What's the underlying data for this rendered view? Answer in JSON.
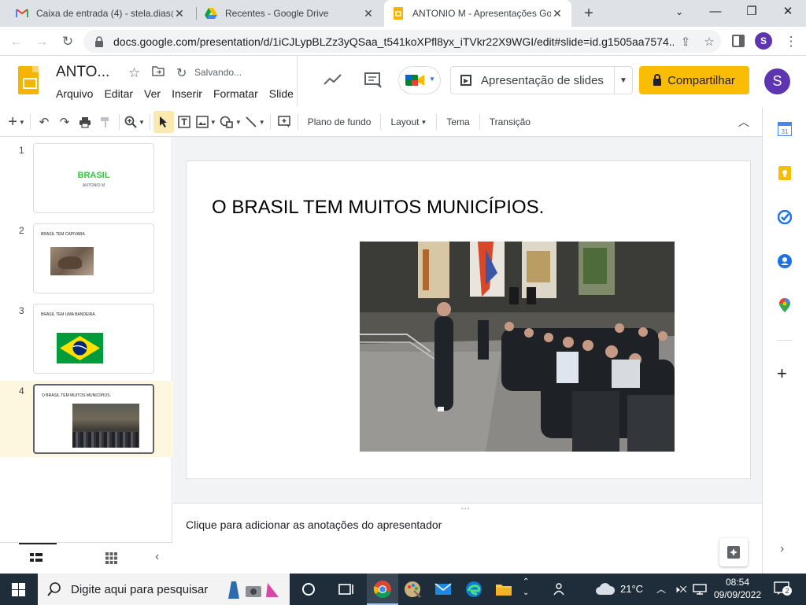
{
  "browser": {
    "tabs": [
      {
        "title": "Caixa de entrada (4) - stela.dias@",
        "favicon": "gmail-icon"
      },
      {
        "title": "Recentes - Google Drive",
        "favicon": "drive-icon"
      },
      {
        "title": "ANTONIO M - Apresentações Go",
        "favicon": "slides-icon"
      }
    ],
    "url": "docs.google.com/presentation/d/1iCJLypBLZz3yQSaa_t541koXPfl8yx_iTVkr22X9WGI/edit#slide=id.g1505aa7574...",
    "profile_initial": "S"
  },
  "app": {
    "doc_title": "ANTO...",
    "saving_status": "Salvando...",
    "menu": [
      "Arquivo",
      "Editar",
      "Ver",
      "Inserir",
      "Formatar",
      "Slide"
    ],
    "present_label": "Apresentação de slides",
    "share_label": "Compartilhar",
    "user_initial": "S"
  },
  "toolbar": {
    "background_label": "Plano de fundo",
    "layout_label": "Layout",
    "theme_label": "Tema",
    "transition_label": "Transição"
  },
  "filmstrip": {
    "slides": [
      {
        "number": "1",
        "title": "BRASIL",
        "subtitle": "ANTONIO M"
      },
      {
        "number": "2",
        "title": "BRASIL TEM CAPIVARA."
      },
      {
        "number": "3",
        "title": "BRASIL TEM UMA BANDEIRA."
      },
      {
        "number": "4",
        "title": "O BRASIL TEM MUITOS MUNICÍPIOS."
      }
    ]
  },
  "slide": {
    "title": "O BRASIL TEM MUITOS MUNICÍPIOS."
  },
  "notes": {
    "placeholder": "Clique para adicionar as anotações do apresentador"
  },
  "taskbar": {
    "search_placeholder": "Digite aqui para pesquisar",
    "weather": "21°C",
    "time": "08:54",
    "date": "09/09/2022",
    "notification_count": "2"
  },
  "colors": {
    "brand_yellow": "#fbbc04",
    "slides_logo": "#f4b400",
    "brasil_green": "#2ecc40",
    "avatar": "#5e35b1"
  }
}
